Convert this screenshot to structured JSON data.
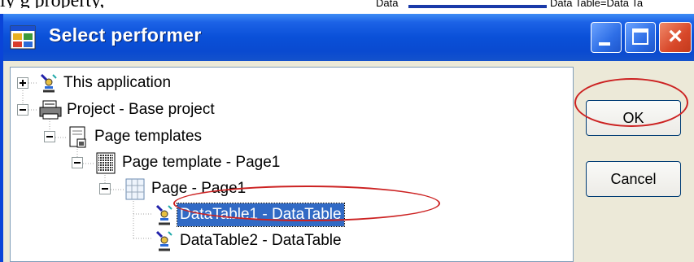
{
  "background_text": {
    "line1": "ly    g            property,",
    "snippet_mid": "Data",
    "snippet_right": "Data Table=Data Ta"
  },
  "window": {
    "title": "Select performer",
    "buttons": {
      "minimize": "minimize",
      "maximize": "maximize",
      "close": "close"
    }
  },
  "tree": {
    "nodes": [
      {
        "label": "This application",
        "expander": "+",
        "icon": "application-icon"
      },
      {
        "label": "Project - Base project",
        "expander": "-",
        "icon": "project-icon"
      },
      {
        "label": "Page templates",
        "expander": "-",
        "icon": "page-templates-icon"
      },
      {
        "label": "Page template - Page1",
        "expander": "-",
        "icon": "page-template-icon"
      },
      {
        "label": "Page - Page1",
        "expander": "-",
        "icon": "page-icon"
      },
      {
        "label": "DataTable1 - DataTable",
        "expander": "",
        "icon": "datatable-icon",
        "selected": true
      },
      {
        "label": "DataTable2 - DataTable",
        "expander": "",
        "icon": "datatable-icon"
      }
    ]
  },
  "actions": {
    "ok": "OK",
    "cancel": "Cancel"
  },
  "colors": {
    "titlebar": "#0a50d8",
    "selection": "#316ac5",
    "annotation": "#cc2222"
  }
}
